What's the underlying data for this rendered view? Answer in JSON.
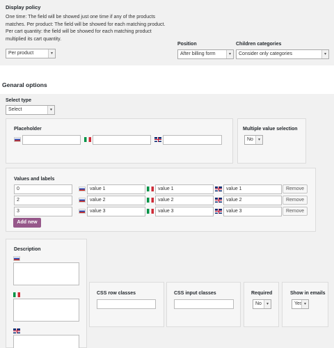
{
  "display_policy": {
    "title": "Display policy",
    "description_lines": [
      "One time: The field will be showed just one time if any of the products",
      "matches. Per product: The field will be showed for each matching product.",
      "Per cart quantity: the field will be showed for each matching product",
      "multiplied its cart quantity."
    ],
    "policy_value": "Per product",
    "position_label": "Position",
    "position_value": "After billing form",
    "children_label": "Children categories",
    "children_value": "Consider only categories"
  },
  "general_options": {
    "heading": "Genaral options",
    "select_type_label": "Select type",
    "select_type_value": "Select"
  },
  "placeholder": {
    "label": "Placeholder",
    "values": [
      "",
      "",
      ""
    ]
  },
  "multiple_value": {
    "label": "Multiple value selection",
    "value": "No"
  },
  "values_and_labels": {
    "label": "Values and labels",
    "rows": [
      {
        "key": "0",
        "ru": "value 1",
        "it": "value 1",
        "gb": "value 1"
      },
      {
        "key": "2",
        "ru": "value 2",
        "it": "value 2",
        "gb": "value 2"
      },
      {
        "key": "3",
        "ru": "value 3",
        "it": "value 3",
        "gb": "value 3"
      }
    ],
    "remove_label": "Remove",
    "add_new_label": "Add new"
  },
  "description": {
    "label": "Description"
  },
  "css_row_classes": {
    "label": "CSS row classes",
    "value": ""
  },
  "css_input_classes": {
    "label": "CSS input classes",
    "value": ""
  },
  "required": {
    "label": "Required",
    "value": "No"
  },
  "show_in_emails": {
    "label": "Show in emails",
    "value": "Yes"
  },
  "icons": {
    "flag_ru": "russia-flag-icon",
    "flag_it": "italy-flag-icon",
    "flag_gb": "uk-flag-icon",
    "dropdown": "chevron-down-icon"
  },
  "colors": {
    "primary_button": "#96588a",
    "panel_background": "#f1f1f1"
  }
}
